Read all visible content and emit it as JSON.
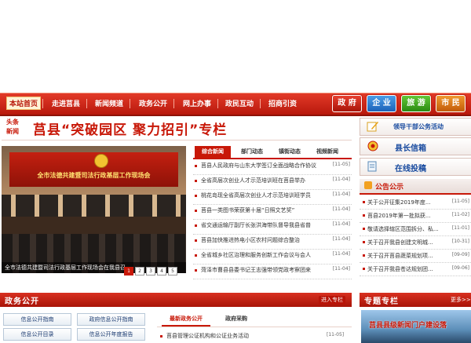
{
  "nav": {
    "items": [
      "本站首页",
      "走进莒县",
      "新闻频道",
      "政务公开",
      "网上办事",
      "政民互动",
      "招商引资"
    ],
    "buttons": [
      "政 府",
      "企 业",
      "旅 游",
      "市 民"
    ]
  },
  "headline": {
    "tag_line1": "头条",
    "tag_line2": "新闻",
    "title": "莒县“突破园区  聚力招引”专栏"
  },
  "photo": {
    "banner_text": "全市法德共建暨司法行政基层工作现场会",
    "caption": "全市法德共建暨司法行政基层工作现场会在我县召...",
    "pages": [
      "1",
      "2",
      "3",
      "4",
      "5"
    ]
  },
  "news_tabs": [
    "综合新闻",
    "部门动态",
    "镇街动态",
    "视频新闻"
  ],
  "news": [
    {
      "title": "莒县人民政府与山东大学签订全面战略合作协议",
      "date": "[11-05]"
    },
    {
      "title": "全省高层次创业人才示范培训班在莒县举办",
      "date": "[11-04]"
    },
    {
      "title": "桃花岛现全省高层次创业人才示范培训班学员",
      "date": "[11-04]"
    },
    {
      "title": "莒县一类图书荣获第十届“日照文艺奖”",
      "date": "[11-04]"
    },
    {
      "title": "省交通运输厅副厅长张洪海带队督导我县省普",
      "date": "[11-04]"
    },
    {
      "title": "莒县加快推进热电小区农村问题综合整治",
      "date": "[11-04]"
    },
    {
      "title": "全省城乡社区治理和服务创新工作会议与会人",
      "date": "[11-04]"
    },
    {
      "title": "菏泽市曹县县委书记王志强带领党政考察团来",
      "date": "[11-04]"
    }
  ],
  "right_buttons": {
    "leader": "领导干部公务活动",
    "mailbox": "县长信箱",
    "online": "在线投稿"
  },
  "notice": {
    "title": "公告公示",
    "items": [
      {
        "title": "关于公开征集2019年度...",
        "date": "[11-05]"
      },
      {
        "title": "莒县2019年第一批拟获...",
        "date": "[11-02]"
      },
      {
        "title": "敬请选择辖区范围拆分、私...",
        "date": "[11-01]"
      },
      {
        "title": "关于召开我县创建文明城...",
        "date": "[10-31]"
      },
      {
        "title": "关于召开莒县蔬菜规划项...",
        "date": "[09-09]"
      },
      {
        "title": "关于召开我县苍达规划团...",
        "date": "[09-06]"
      }
    ]
  },
  "gov": {
    "title": "政务公开",
    "more": "进入专栏",
    "guides": [
      "信息公开指南",
      "政府信息公开指南",
      "信息公开目录",
      "信息公开年度报告"
    ]
  },
  "bottom_tabs": [
    "最新政务公开",
    "政府采购"
  ],
  "bottom_news": [
    {
      "title": "莒县管理公证机构和公证业务活动",
      "date": "[11-05]"
    }
  ],
  "topic": {
    "title": "专题专栏",
    "more": "更多>>",
    "image_text": "莒县县级新闻门户建设落"
  },
  "colors": {
    "brand_red": "#c81808",
    "nav_blue": "#1a4ca0"
  }
}
